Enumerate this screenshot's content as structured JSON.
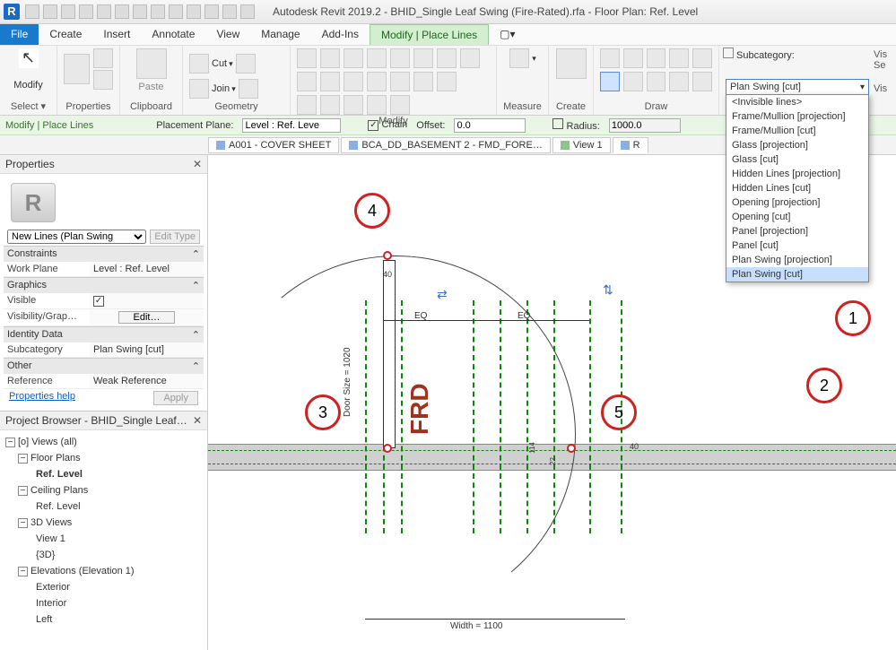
{
  "titlebar": {
    "title": "Autodesk Revit 2019.2 - BHID_Single Leaf Swing (Fire-Rated).rfa - Floor Plan: Ref. Level"
  },
  "menus": {
    "file": "File",
    "create": "Create",
    "insert": "Insert",
    "annotate": "Annotate",
    "view": "View",
    "manage": "Manage",
    "addins": "Add-Ins",
    "context": "Modify | Place Lines"
  },
  "ribbon": {
    "select": "Select ▾",
    "properties": "Properties",
    "clipboard": "Clipboard",
    "geometry": "Geometry",
    "modify": "Modify",
    "measure": "Measure",
    "create": "Create",
    "draw": "Draw",
    "modify_label": "Modify",
    "paste": "Paste",
    "cut": "Cut",
    "join": "Join",
    "subcat_label": "Subcategory:",
    "subcat_value": "Plan Swing [cut]",
    "right1": "Vis",
    "right2": "Se",
    "right3": "Vis"
  },
  "optionsbar": {
    "context": "Modify | Place Lines",
    "plane_label": "Placement Plane:",
    "plane_value": "Level : Ref. Leve",
    "chain": "Chain",
    "offset_label": "Offset:",
    "offset_value": "0.0",
    "radius_label": "Radius:",
    "radius_value": "1000.0"
  },
  "viewtabs": {
    "t1": "A001 - COVER SHEET",
    "t2": "BCA_DD_BASEMENT 2 - FMD_FORE…",
    "t3": "View 1",
    "t4": "R"
  },
  "properties": {
    "title": "Properties",
    "type": "New Lines (Plan Swing",
    "edit_type": "Edit Type",
    "cat_constraints": "Constraints",
    "workplane_k": "Work Plane",
    "workplane_v": "Level : Ref. Level",
    "cat_graphics": "Graphics",
    "visible_k": "Visible",
    "vg_k": "Visibility/Grap…",
    "vg_v": "Edit…",
    "cat_identity": "Identity Data",
    "subcat_k": "Subcategory",
    "subcat_v": "Plan Swing [cut]",
    "cat_other": "Other",
    "ref_k": "Reference",
    "ref_v": "Weak Reference",
    "help": "Properties help",
    "apply": "Apply"
  },
  "browser": {
    "title": "Project Browser - BHID_Single Leaf…",
    "views": "Views (all)",
    "fp": "Floor Plans",
    "ref": "Ref. Level",
    "cp": "Ceiling Plans",
    "ref2": "Ref. Level",
    "v3d": "3D Views",
    "v1": "View 1",
    "v3d2": "{3D}",
    "elev": "Elevations (Elevation 1)",
    "ext": "Exterior",
    "int": "Interior",
    "left": "Left"
  },
  "subcat_items": [
    "<Invisible lines>",
    "Frame/Mullion [projection]",
    "Frame/Mullion [cut]",
    "Glass [projection]",
    "Glass [cut]",
    "Hidden Lines [projection]",
    "Hidden Lines [cut]",
    "Opening [projection]",
    "Opening [cut]",
    "Panel [projection]",
    "Panel [cut]",
    "Plan Swing [projection]",
    "Plan Swing [cut]"
  ],
  "canvas": {
    "frd": "FRD",
    "eq1": "EQ",
    "eq2": "EQ",
    "doorsize": "Door Size = 1020",
    "width": "Width = 1100",
    "d40a": "40",
    "d40b": "40",
    "d22": "22",
    "d114": "114"
  },
  "callouts": {
    "c1": "1",
    "c2": "2",
    "c3": "3",
    "c4": "4",
    "c5": "5"
  }
}
